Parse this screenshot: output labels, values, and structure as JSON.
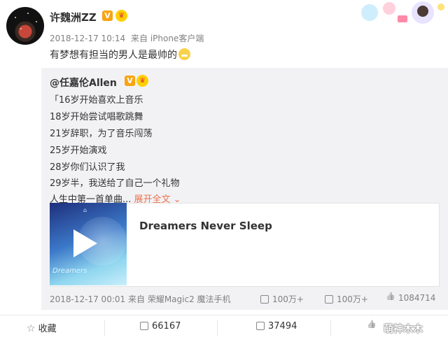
{
  "post": {
    "author": "许魏洲ZZ",
    "verified_badge": "V",
    "member_badge": "crown-icon",
    "time": "2018-12-17 10:14",
    "source_prefix": "来自",
    "source": "iPhone客户端",
    "content": "有梦想有担当的男人是最帅的"
  },
  "repost": {
    "author": "@任嘉伦Allen",
    "verified_badge": "V",
    "lines": [
      "「16岁开始喜欢上音乐",
      "18岁开始尝试唱歌跳舞",
      "21岁辞职，为了音乐闯荡",
      "25岁开始演戏",
      "28岁你们认识了我",
      "29岁半，我送给了自己一个礼物",
      "人生中第一首单曲..."
    ],
    "expand_label": "展开全文 ⌄",
    "card": {
      "title": "Dreamers Never Sleep",
      "cover_logo": "⌂",
      "cover_script": "Dreamers"
    },
    "time": "2018-12-17 00:01",
    "source_prefix": "来自",
    "source": "荣耀Magic2 魔法手机",
    "reposts": "100万+",
    "comments": "100万+",
    "likes": "1084714"
  },
  "actions": {
    "favorite_label": "收藏",
    "repost_count": "66167",
    "comment_count": "37494",
    "like_icon": "thumbs-up-icon"
  },
  "watermark": "萌神木木",
  "colors": {
    "link": "#eb7350",
    "badge": "#f9a411",
    "meta": "#808080"
  }
}
